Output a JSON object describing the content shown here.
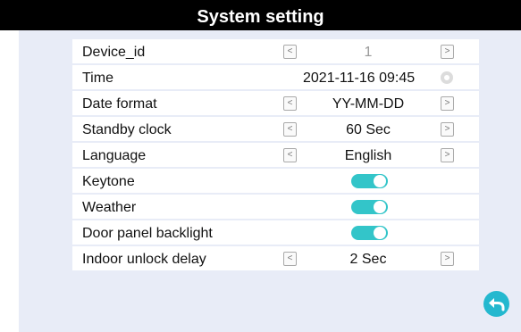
{
  "header": {
    "title": "System setting"
  },
  "settings": {
    "device_id": {
      "label": "Device_id",
      "value": "1"
    },
    "time": {
      "label": "Time",
      "value": "2021-11-16 09:45"
    },
    "date_format": {
      "label": "Date format",
      "value": "YY-MM-DD"
    },
    "standby_clock": {
      "label": "Standby clock",
      "value": "60 Sec"
    },
    "language": {
      "label": "Language",
      "value": "English"
    },
    "keytone": {
      "label": "Keytone",
      "on": true
    },
    "weather": {
      "label": "Weather",
      "on": true
    },
    "door_panel_backlight": {
      "label": "Door panel backlight",
      "on": true
    },
    "indoor_unlock_delay": {
      "label": "Indoor unlock delay",
      "value": "2 Sec"
    }
  },
  "arrows": {
    "left": "<",
    "right": ">"
  },
  "icons": {
    "time_settings": "gear-icon",
    "back": "back-arrow-icon"
  },
  "colors": {
    "toggle_on": "#33c5c9",
    "back_button": "#24b8cf",
    "background": "#e8ecf7",
    "header": "#000000"
  }
}
